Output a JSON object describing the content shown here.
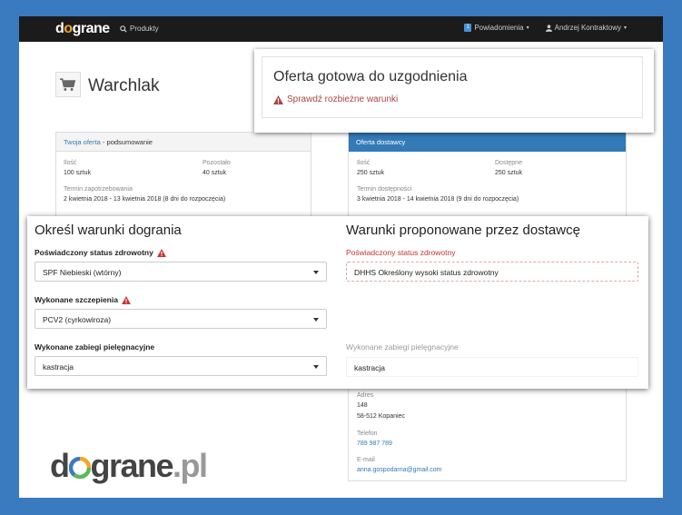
{
  "navbar": {
    "brand_pre": "d",
    "brand_post": "grane",
    "products": "Produkty",
    "notifications_count": "1",
    "notifications": "Powiadomienia",
    "user": "Andrzej Kontraktowy"
  },
  "page": {
    "title": "Warchlak"
  },
  "your_offer": {
    "header_link": "Twoja oferta",
    "header_rest": " - podsumowanie",
    "qty_label": "Ilość",
    "qty_value": "100 sztuk",
    "rem_label": "Pozostało",
    "rem_value": "40 sztuk",
    "date_label": "Termin zapotrzebowania",
    "date_value": "2 kwietnia 2018 - 13 kwietnia 2018 (8 dni do rozpoczęcia)"
  },
  "supplier_offer": {
    "header": "Oferta dostawcy",
    "qty_label": "Ilość",
    "qty_value": "250 sztuk",
    "avail_label": "Dostępne",
    "avail_value": "250 sztuk",
    "date_label": "Termin dostępności",
    "date_value": "3 kwietnia 2018 - 14 kwietnia 2018 (9 dni do rozpoczęcia)",
    "address_label": "Adres",
    "address_line1": "148",
    "address_line2": "58-512 Kopaniec",
    "phone_label": "Telefon",
    "phone_value": "789 987 789",
    "email_label": "E-mail",
    "email_value": "anna.gospodarna@gmail.com"
  },
  "offer_status": {
    "title": "Oferta gotowa do uzgodnienia",
    "warning": "Sprawdź rozbieżne warunki"
  },
  "conditions": {
    "left_title": "Określ warunki dogrania",
    "right_title": "Warunki proponowane przez dostawcę",
    "health_label": "Poświadczony status zdrowotny",
    "health_value": "SPF Niebieski (wtórny)",
    "vacc_label": "Wykonane szczepienia",
    "vacc_value": "PCV2 (cyrkowiroza)",
    "care_label": "Wykonane zabiegi pielęgnacyjne",
    "care_value": "kastracja",
    "sup_health_label": "Poświadczony status zdrowotny",
    "sup_health_value": "DHHS Określony wysoki status zdrowotny",
    "sup_care_label": "Wykonane zabiegi pielęgnacyjne",
    "sup_care_value": "kastracja"
  },
  "footer_logo": {
    "pre": "d",
    "mid": "grane",
    "suffix": ".pl"
  },
  "colors": {
    "accent": "#337ab7",
    "warning": "#a94442",
    "frame": "#3a7bbf",
    "logo_orange": "#f5a623",
    "logo_green": "#5cb85c"
  },
  "icons": [
    "search-icon",
    "bell-badge",
    "user-icon",
    "cart-icon",
    "warning-icon",
    "chevron-down-icon"
  ]
}
